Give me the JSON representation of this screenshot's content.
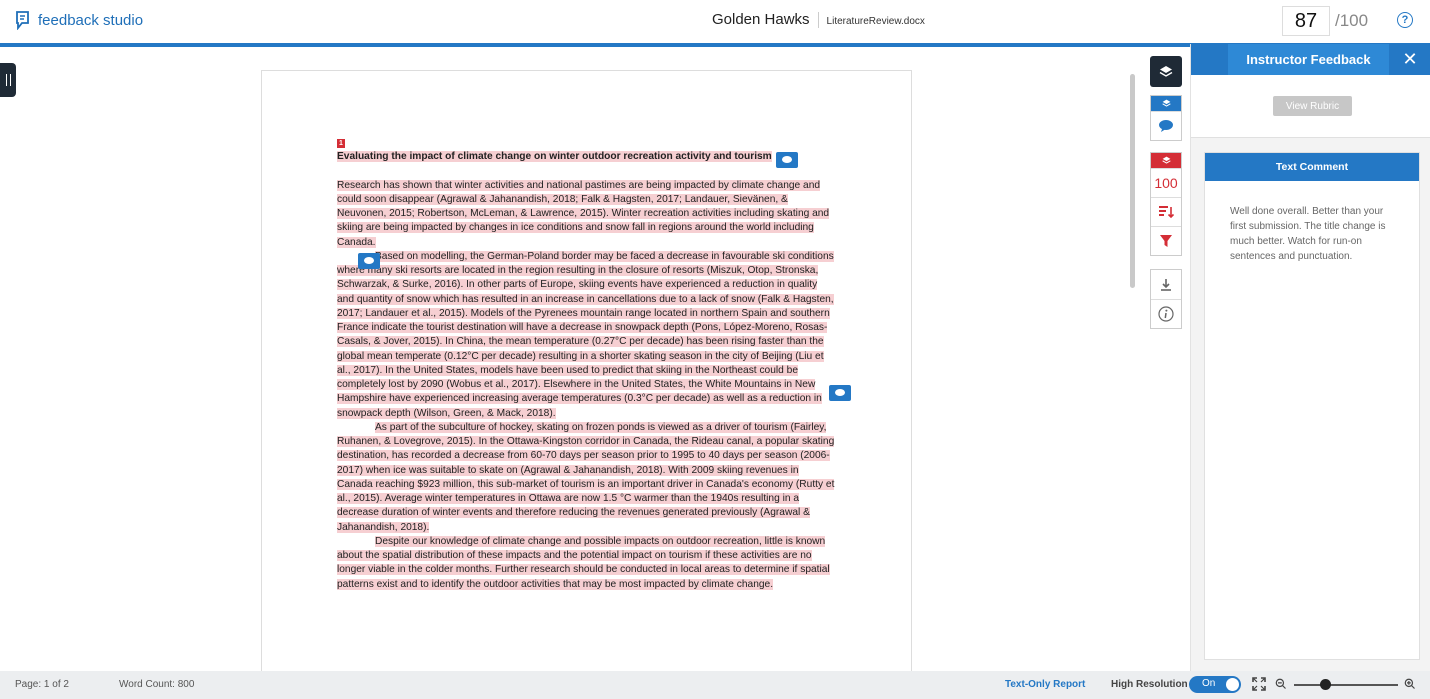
{
  "brand": {
    "name": "feedback studio"
  },
  "header": {
    "course": "Golden Hawks",
    "file": "LiteratureReview.docx"
  },
  "score": {
    "value": "87",
    "max": "/100"
  },
  "help": {
    "label": "?"
  },
  "document": {
    "marker": "1",
    "title": "Evaluating the impact of climate change on winter outdoor recreation activity and tourism",
    "paragraphs": [
      "Research has shown that winter activities and national pastimes are being impacted by climate change and could soon disappear (Agrawal & Jahanandish, 2018; Falk & Hagsten, 2017; Landauer, Sievänen, & Neuvonen, 2015; Robertson, McLeman, & Lawrence, 2015). Winter recreation activities including skating and skiing are being impacted by changes in ice conditions and snow fall in regions around the world including Canada.",
      "Based on modelling, the German-Poland border may be faced a decrease in favourable ski conditions where many ski resorts are located in the region resulting in the closure of resorts (Miszuk, Otop, Stronska, Schwarzak, & Surke, 2016). In other parts of Europe, skiing events have experienced a reduction in quality and quantity of snow which has resulted in an increase in cancellations due to a lack of snow (Falk & Hagsten, 2017; Landauer et al., 2015). Models of the Pyrenees mountain range located in northern Spain and southern France indicate the tourist destination will have a decrease in snowpack depth (Pons, López-Moreno, Rosas-Casals, & Jover, 2015). In China, the mean temperature (0.27°C per decade) has been rising faster than the global mean temperate (0.12°C per decade) resulting in a shorter skating season in the city of Beijing (Liu et al., 2017). In the United States, models have been used to predict that skiing in the Northeast could be completely lost by 2090 (Wobus et al., 2017). Elsewhere in the United States, the White Mountains in New Hampshire have experienced increasing average temperatures (0.3°C per decade) as well as a reduction in snowpack depth (Wilson, Green, & Mack, 2018).",
      "As part of the subculture of hockey, skating on frozen ponds is viewed as a driver of tourism (Fairley, Ruhanen, & Lovegrove, 2015). In the Ottawa-Kingston corridor in Canada, the Rideau canal, a popular skating destination, has recorded a decrease from 60-70 days per season prior to 1995 to 40 days per season (2006-2017) when ice was suitable to skate on (Agrawal & Jahanandish, 2018). With 2009 skiing revenues in Canada reaching $923 million, this sub-market of tourism is an important driver in Canada's economy (Rutty et al., 2015). Average winter temperatures in Ottawa are now 1.5 °C warmer than the 1940s resulting in a decrease duration of winter events and therefore reducing the revenues generated previously (Agrawal & Jahanandish, 2018).",
      "Despite our knowledge of climate change and possible impacts on outdoor recreation, little is known about the spatial distribution of these impacts and the potential impact on tourism if these activities are no longer viable in the colder months. Further research should be conducted in local areas to determine if spatial patterns exist and to identify the outdoor activities that may be most impacted by climate change."
    ]
  },
  "toolstrip": {
    "grade_value": "100"
  },
  "panel": {
    "tab_label": "Instructor Feedback",
    "close_label": "✕",
    "rubric_button": "View Rubric",
    "comment_title": "Text Comment",
    "comment_body": "Well done overall. Better than your first submission. The title change is much better. Watch for run-on sentences and punctuation."
  },
  "statusbar": {
    "page": "Page: 1 of 2",
    "word_count": "Word Count: 800",
    "text_only_report": "Text-Only Report",
    "high_resolution": "High Resolution",
    "toggle_state": "On"
  },
  "colors": {
    "accent": "#2478c5",
    "alert": "#d42e36",
    "highlight": "#f6cfd2"
  }
}
